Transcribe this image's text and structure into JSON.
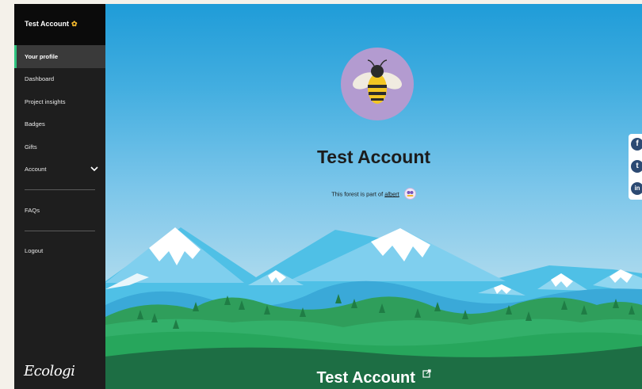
{
  "sidebar": {
    "account_title": "Test Account",
    "account_badge": "✿",
    "items": [
      {
        "label": "Your profile",
        "active": true
      },
      {
        "label": "Dashboard"
      },
      {
        "label": "Project insights"
      },
      {
        "label": "Badges"
      },
      {
        "label": "Gifts"
      },
      {
        "label": "Account",
        "icon": "chevron-down-icon"
      }
    ],
    "faq_label": "FAQs",
    "logout_label": "Logout",
    "logo_text": "Ecologi"
  },
  "profile": {
    "avatar": "bee-icon",
    "name": "Test Account",
    "forest_prefix": "This forest is part of",
    "forest_link": "albert",
    "bottom_title": "Test Account",
    "edit_icon": "external-link-icon"
  },
  "social": [
    {
      "glyph": "f",
      "icon": "facebook-icon"
    },
    {
      "glyph": "t",
      "icon": "twitter-icon"
    },
    {
      "glyph": "in",
      "icon": "linkedin-icon"
    }
  ],
  "colors": {
    "sidebar_bg": "#1e1e1e",
    "active_accent": "#2ec27e",
    "sky_top": "#1f9cd8",
    "avatar_bg": "#b39bd0",
    "social_bg": "#2c4a73"
  }
}
